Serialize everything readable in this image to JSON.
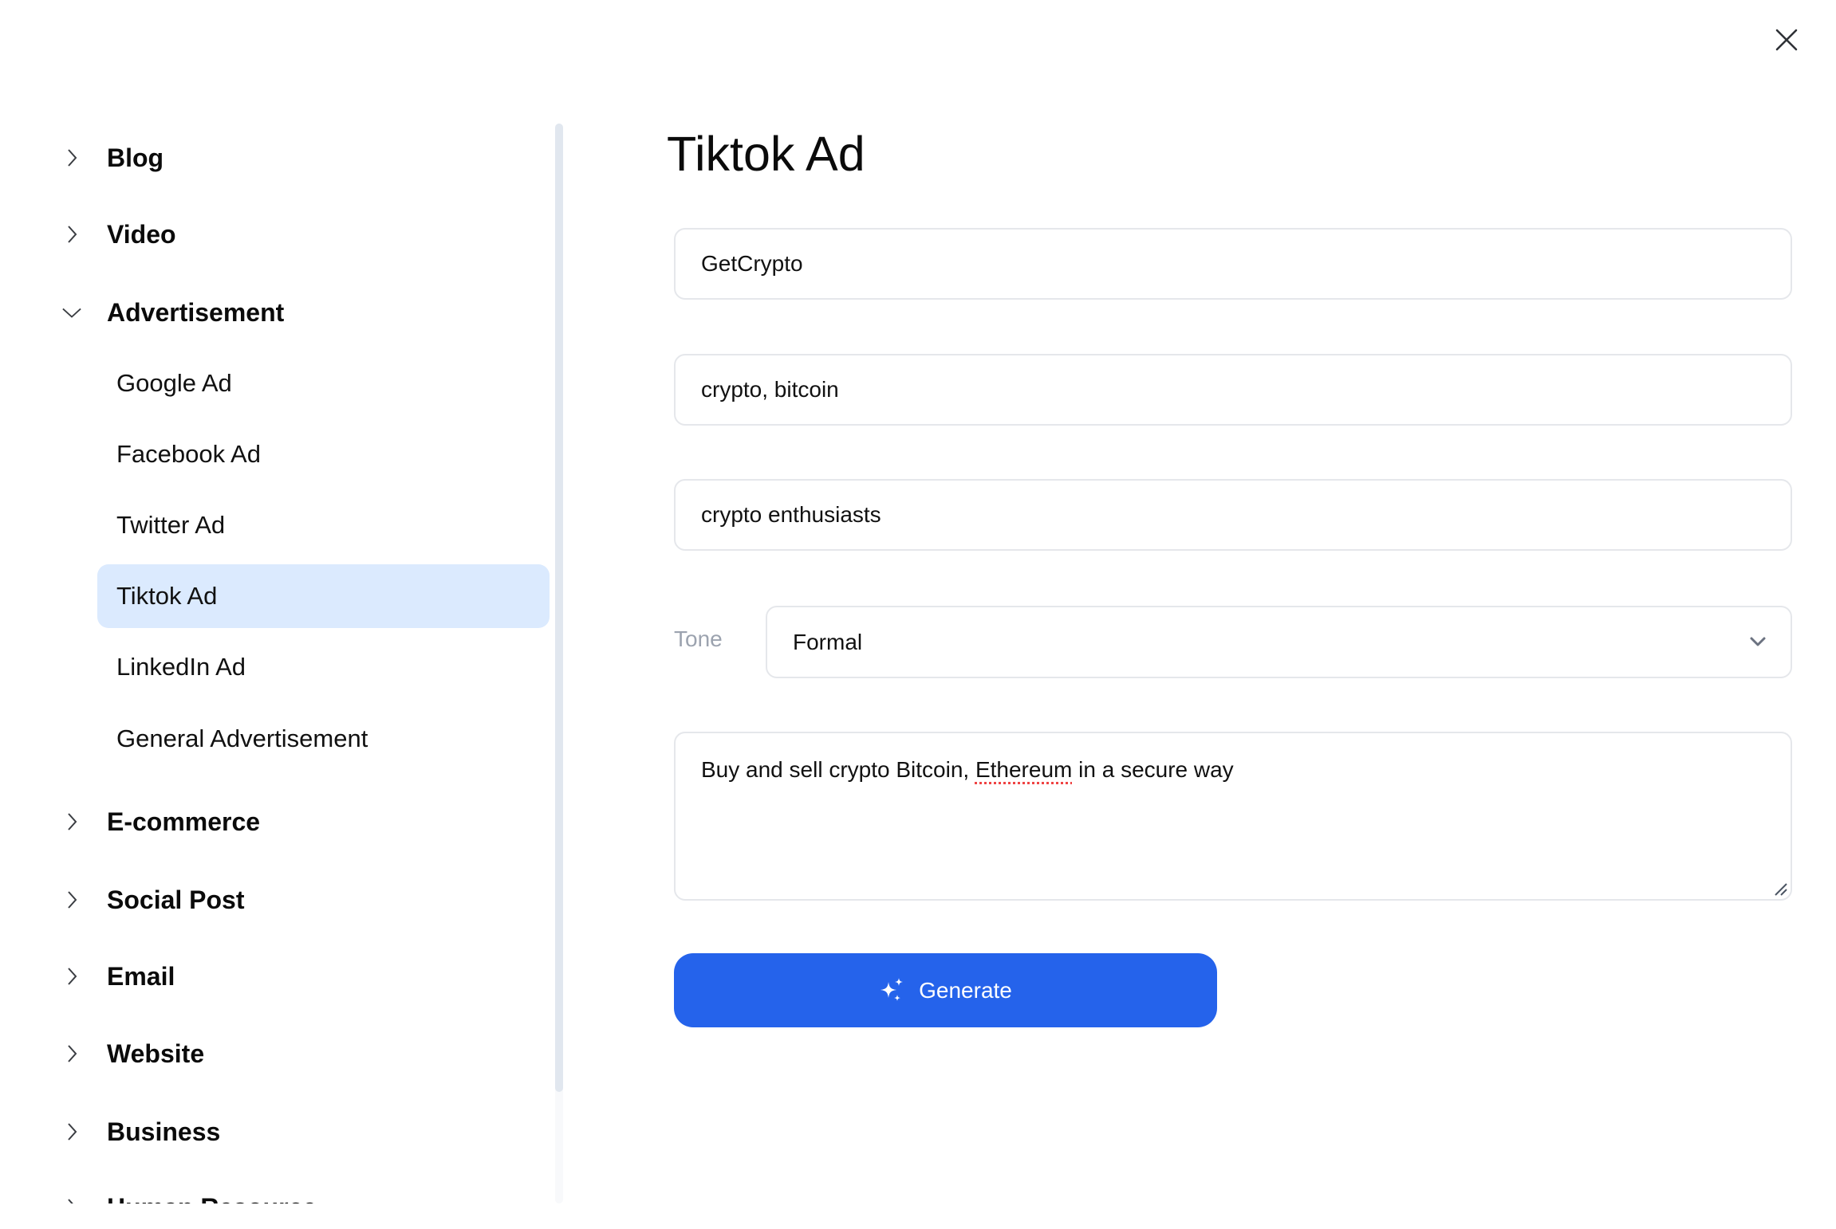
{
  "close": {
    "icon": "close-icon"
  },
  "sidebar": {
    "groups": [
      {
        "label": "Blog",
        "expanded": false
      },
      {
        "label": "Video",
        "expanded": false
      },
      {
        "label": "Advertisement",
        "expanded": true,
        "items": [
          {
            "label": "Google Ad",
            "active": false
          },
          {
            "label": "Facebook Ad",
            "active": false
          },
          {
            "label": "Twitter Ad",
            "active": false
          },
          {
            "label": "Tiktok Ad",
            "active": true
          },
          {
            "label": "LinkedIn Ad",
            "active": false
          },
          {
            "label": "General Advertisement",
            "active": false
          }
        ]
      },
      {
        "label": "E-commerce",
        "expanded": false
      },
      {
        "label": "Social Post",
        "expanded": false
      },
      {
        "label": "Email",
        "expanded": false
      },
      {
        "label": "Website",
        "expanded": false
      },
      {
        "label": "Business",
        "expanded": false
      },
      {
        "label": "Human Resource",
        "expanded": false
      }
    ]
  },
  "main": {
    "title": "Tiktok Ad",
    "fields": {
      "product_name": "GetCrypto",
      "keywords": "crypto, bitcoin",
      "audience": "crypto enthusiasts"
    },
    "tone": {
      "label": "Tone",
      "value": "Formal"
    },
    "description": {
      "before": "Buy and sell crypto Bitcoin, ",
      "misspelled": "Ethereum",
      "after": " in a secure way"
    },
    "generate_label": "Generate"
  },
  "colors": {
    "accent": "#2563eb",
    "active_item_bg": "#dbeafe",
    "border": "#e5e7eb",
    "muted_text": "#9ca3af"
  }
}
